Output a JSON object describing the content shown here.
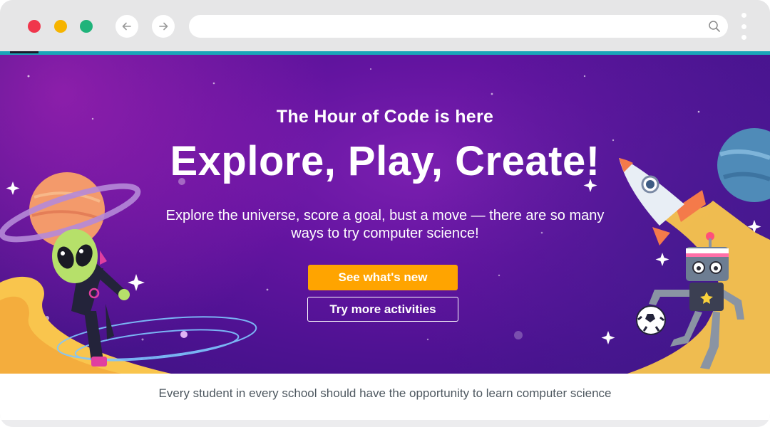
{
  "browser": {
    "url": "",
    "icons": {
      "close": "red-dot",
      "minimize": "yellow-dot",
      "maximize": "green-dot",
      "back": "arrow-left-icon",
      "forward": "arrow-right-icon",
      "search": "search-icon",
      "menu": "kebab-menu-icon"
    },
    "colors": {
      "close": "#f0364c",
      "minimize": "#f6b400",
      "maximize": "#1fb37a",
      "accent_line": "#1aa5b8"
    }
  },
  "hero": {
    "eyebrow": "The Hour of Code is here",
    "headline": "Explore, Play, Create!",
    "subcopy": "Explore the universe, score a goal, bust a move — there are so many ways to try computer science!",
    "primary_button": "See what's new",
    "secondary_button": "Try more activities",
    "colors": {
      "background": "#6314a0",
      "primary_button": "#ffa400"
    },
    "illustrations": [
      "ringed-planet",
      "alien-astronaut",
      "rocket",
      "blue-planet",
      "robot",
      "soccer-ball"
    ]
  },
  "footer": {
    "tagline": "Every student in every school should have the opportunity to learn computer science"
  }
}
